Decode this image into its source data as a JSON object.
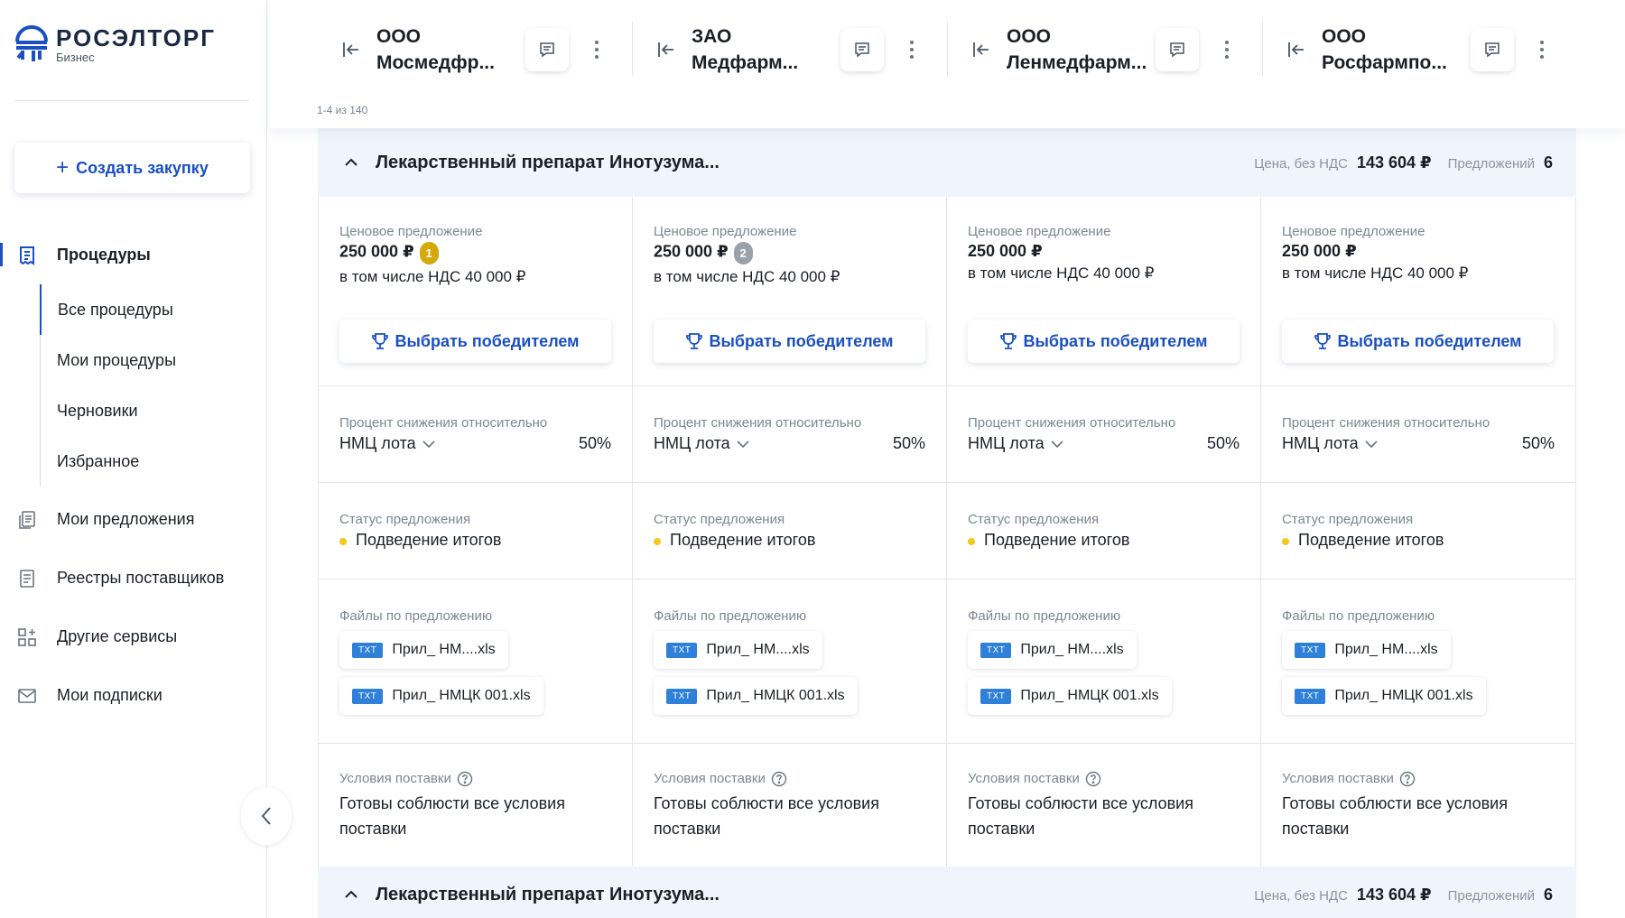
{
  "brand": {
    "title": "РОСЭЛТОРГ",
    "subtitle": "Бизнес",
    "accent": "#1a4fc4"
  },
  "sidebar": {
    "create_label": "Создать закупку",
    "items": [
      {
        "label": "Процедуры",
        "icon": "document-list-icon",
        "active": true
      },
      {
        "label": "Мои предложения",
        "icon": "documents-icon"
      },
      {
        "label": "Реестры поставщиков",
        "icon": "registry-icon"
      },
      {
        "label": "Другие сервисы",
        "icon": "apps-grid-icon"
      },
      {
        "label": "Мои подписки",
        "icon": "mail-icon"
      }
    ],
    "subitems": [
      {
        "label": "Все процедуры",
        "active": true
      },
      {
        "label": "Мои процедуры"
      },
      {
        "label": "Черновики"
      },
      {
        "label": "Избранное"
      }
    ]
  },
  "header": {
    "paging": "1-4 из 140",
    "suppliers": [
      {
        "line1": "ООО",
        "line2": "Мосмедфр..."
      },
      {
        "line1": "ЗАО",
        "line2": "Медфарм..."
      },
      {
        "line1": "ООО",
        "line2": "Ленмедфарм..."
      },
      {
        "line1": "ООО",
        "line2": "Росфармпо..."
      }
    ]
  },
  "lot": {
    "title": "Лекарственный препарат Инотузума...",
    "price_label": "Цена, без НДС",
    "price_value": "143 604 ₽",
    "offers_label": "Предложений",
    "offers_value": "6"
  },
  "lot2": {
    "title": "Лекарственный препарат Инотузума...",
    "price_label": "Цена, без НДС",
    "price_value": "143 604 ₽",
    "offers_label": "Предложений",
    "offers_value": "6"
  },
  "labels": {
    "price_offer": "Ценовое предложение",
    "vat_note": "в том числе НДС 40 000 ₽",
    "choose_winner": "Выбрать победителем",
    "reduction": "Процент снижения относительно",
    "reduction_basis": "НМЦ лота",
    "status": "Статус предложения",
    "files": "Файлы по предложению",
    "delivery": "Условия поставки"
  },
  "offers": [
    {
      "price": "250 000 ₽",
      "rank": "1",
      "rank_color": "#d4a90c",
      "pct": "50%",
      "status": "Подведение итогов",
      "files": [
        {
          "tag": "TXT",
          "name": "Прил_ НМ....xls"
        },
        {
          "tag": "TXT",
          "name": "Прил_ НМЦК 001.xls"
        }
      ],
      "delivery_1": "Готовы соблюсти все условия",
      "delivery_2": "поставки"
    },
    {
      "price": "250 000 ₽",
      "rank": "2",
      "rank_color": "#9aa1ab",
      "pct": "50%",
      "status": "Подведение итогов",
      "files": [
        {
          "tag": "TXT",
          "name": "Прил_ НМ....xls"
        },
        {
          "tag": "TXT",
          "name": "Прил_ НМЦК 001.xls"
        }
      ],
      "delivery_1": "Готовы соблюсти все условия",
      "delivery_2": "поставки"
    },
    {
      "price": "250 000 ₽",
      "rank": "",
      "pct": "50%",
      "status": "Подведение итогов",
      "files": [
        {
          "tag": "TXT",
          "name": "Прил_ НМ....xls"
        },
        {
          "tag": "TXT",
          "name": "Прил_ НМЦК 001.xls"
        }
      ],
      "delivery_1": "Готовы соблюсти все условия",
      "delivery_2": "поставки"
    },
    {
      "price": "250 000 ₽",
      "rank": "",
      "pct": "50%",
      "status": "Подведение итогов",
      "files": [
        {
          "tag": "TXT",
          "name": "Прил_ НМ....xls"
        },
        {
          "tag": "TXT",
          "name": "Прил_ НМЦК 001.xls"
        }
      ],
      "delivery_1": "Готовы соблюсти все условия",
      "delivery_2": "поставки"
    }
  ],
  "colors": {
    "status_dot": "#f2c81b",
    "lot_bg": "#f0f5fd",
    "file_tag": "#2f80d8"
  }
}
